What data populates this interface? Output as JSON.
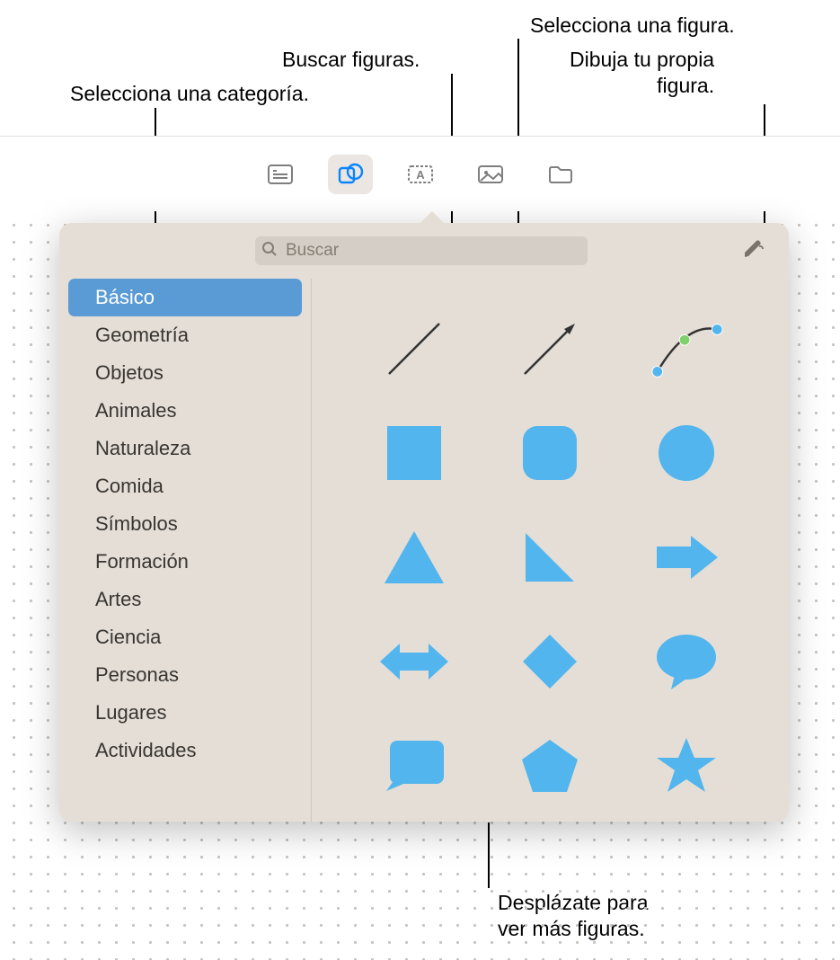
{
  "callouts": {
    "selectShape": "Selecciona una figura.",
    "searchShapes": "Buscar figuras.",
    "selectCategory": "Selecciona una categoría.",
    "drawOwn": "Dibuja tu propia\nfigura.",
    "scrollMore": "Desplázate para\nver más figuras."
  },
  "search": {
    "placeholder": "Buscar"
  },
  "sidebar": {
    "items": [
      "Básico",
      "Geometría",
      "Objetos",
      "Animales",
      "Naturaleza",
      "Comida",
      "Símbolos",
      "Formación",
      "Artes",
      "Ciencia",
      "Personas",
      "Lugares",
      "Actividades"
    ],
    "selectedIndex": 0
  },
  "shapes": [
    "line",
    "arrow-line",
    "bezier",
    "square",
    "rounded-square",
    "circle",
    "triangle",
    "right-triangle",
    "arrow-right",
    "arrow-left-right",
    "diamond",
    "speech-bubble",
    "callout-rect",
    "pentagon",
    "star"
  ],
  "colors": {
    "shapeFill": "#52b5ed",
    "popoverBg": "#e5ded7",
    "selected": "#5a9bd5"
  }
}
